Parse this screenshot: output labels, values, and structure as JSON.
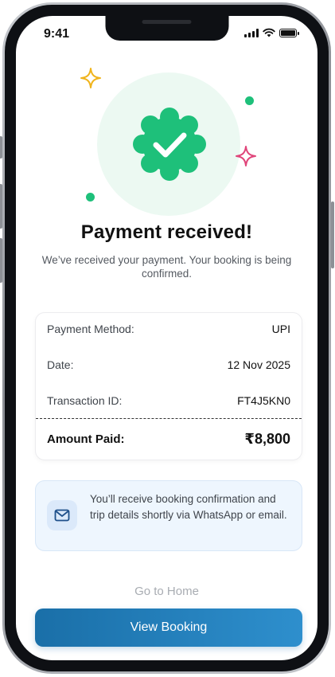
{
  "status_bar": {
    "time": "9:41"
  },
  "hero": {
    "title": "Payment received!",
    "subtitle": "We’ve received your payment. Your booking is being confirmed."
  },
  "details": {
    "rows": [
      {
        "label": "Payment Method:",
        "value": "UPI"
      },
      {
        "label": "Date:",
        "value": "12 Nov 2025"
      },
      {
        "label": "Transaction ID:",
        "value": "FT4J5KN0"
      }
    ],
    "total": {
      "label": "Amount Paid:",
      "value": "₹8,800"
    }
  },
  "info": {
    "text": "You’ll receive booking confirmation and trip details shortly via WhatsApp or email.",
    "icon": "mail-icon"
  },
  "actions": {
    "home_label": "Go to Home",
    "view_booking_label": "View Booking"
  },
  "colors": {
    "success": "#1ec07a",
    "hero_bg": "#ecf9f2",
    "primary": "#1a6fa8",
    "accent_yellow": "#f0b41c",
    "accent_pink": "#e0457a",
    "info_bg": "#eef6fe"
  }
}
